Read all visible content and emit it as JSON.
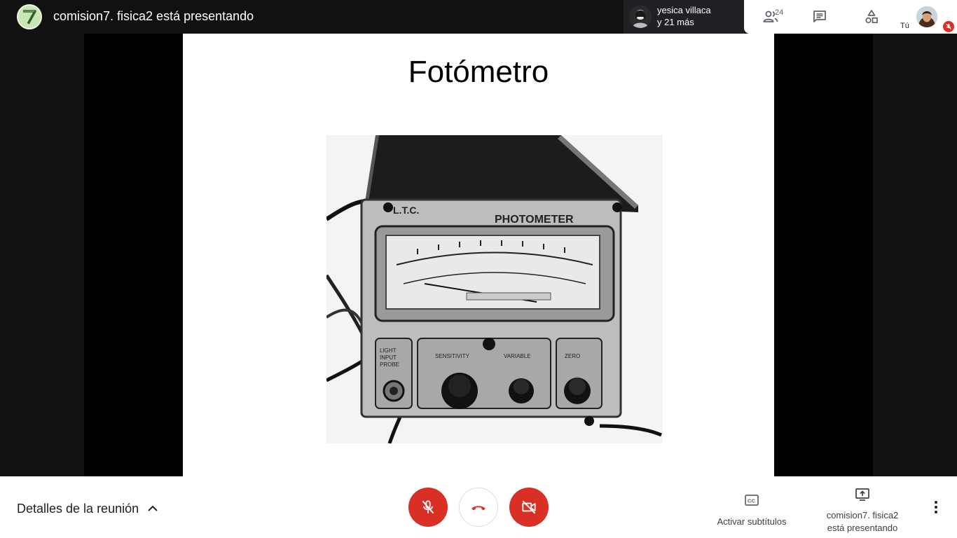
{
  "topbar": {
    "presenter_avatar_icon": "number-seven-avatar",
    "presenter_title": "comision7. fisica2 está presentando",
    "participant_chip": {
      "line1": "yesica villaca",
      "line2": "y 21 más"
    },
    "people_icon": "people-icon",
    "people_count": "24",
    "chat_icon": "chat-icon",
    "activities_icon": "activities-icon",
    "self_label": "Tú",
    "self_mic_state": "muted"
  },
  "slide": {
    "title": "Fotómetro",
    "image_label": "PHOTOMETER"
  },
  "bottombar": {
    "meeting_details": "Detalles de la reunión",
    "captions_label": "Activar subtítulos",
    "presenting_label_line1": "comision7. fisica2",
    "presenting_label_line2": "está presentando"
  },
  "colors": {
    "accent_red": "#d93025",
    "dark_bg": "#111111",
    "bar_bg": "#ffffff"
  }
}
